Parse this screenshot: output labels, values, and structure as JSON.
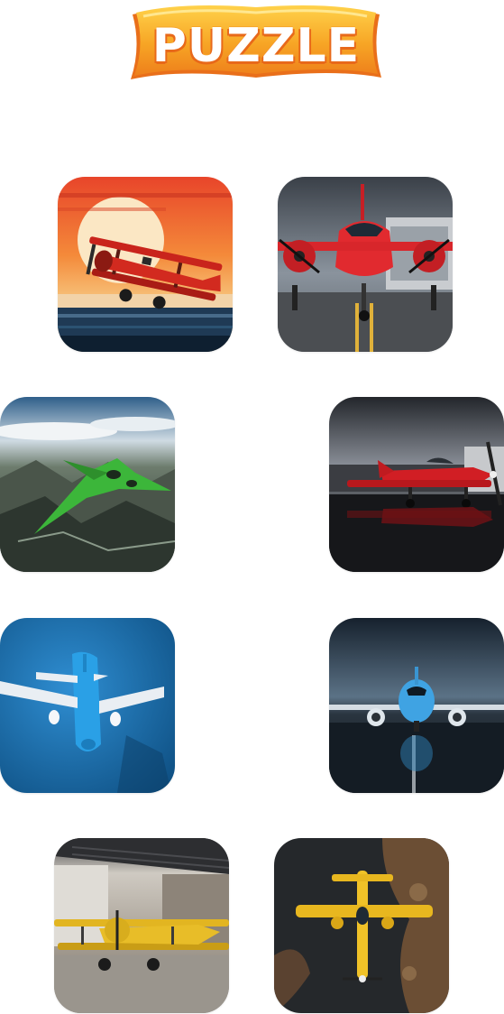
{
  "title": {
    "text": "PUZZLE",
    "colors": {
      "fill": "#ffffff",
      "banner": "#f7a525",
      "banner_dark": "#e9721a"
    }
  },
  "puzzles": [
    {
      "name": "red-biplane-sunset",
      "icon": "biplane-icon",
      "palette": [
        "#f26b2a",
        "#1d3b52",
        "#c9261d"
      ]
    },
    {
      "name": "red-twin-prop-hangar",
      "icon": "propeller-plane-icon",
      "palette": [
        "#5b6470",
        "#d8242a",
        "#2d2f33"
      ]
    },
    {
      "name": "green-jet-mountains",
      "icon": "jet-icon",
      "palette": [
        "#8fb3cf",
        "#3a4b3a",
        "#3fbd3c"
      ]
    },
    {
      "name": "red-racer-runway",
      "icon": "propeller-plane-icon",
      "palette": [
        "#3c3f45",
        "#d31f25",
        "#1b1c1f"
      ]
    },
    {
      "name": "blue-airliner-ocean",
      "icon": "airliner-icon",
      "palette": [
        "#1a6aa6",
        "#2f8fd0",
        "#e7eef5"
      ]
    },
    {
      "name": "blue-airliner-storm",
      "icon": "airliner-icon",
      "palette": [
        "#1e2c3c",
        "#4aa7e0",
        "#0f1620"
      ]
    },
    {
      "name": "yellow-biplane-hangar",
      "icon": "biplane-icon",
      "palette": [
        "#a9a29a",
        "#e2b521",
        "#5d5a55"
      ]
    },
    {
      "name": "yellow-plane-overhead",
      "icon": "propeller-plane-icon",
      "palette": [
        "#232629",
        "#f0c228",
        "#7a5a3c"
      ]
    }
  ]
}
